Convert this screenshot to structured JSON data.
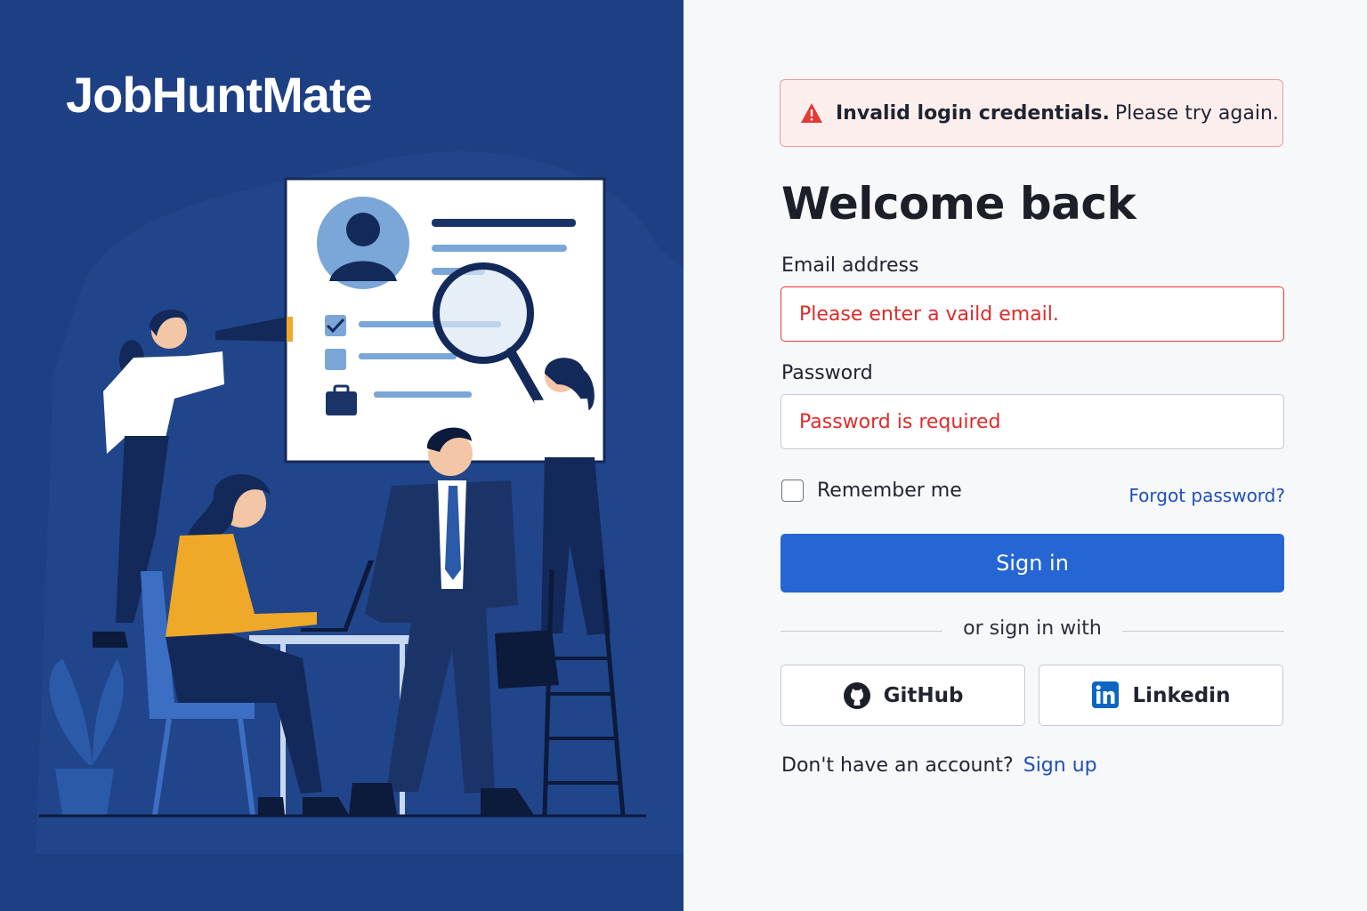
{
  "brand": {
    "name": "JobHuntMate"
  },
  "alert": {
    "strong": "Invalid login credentials.",
    "text": "Please try again.",
    "icon": "warning-triangle-icon",
    "color": "#e53935"
  },
  "form": {
    "title": "Welcome back",
    "email": {
      "label": "Email address",
      "error": "Please enter a vaild email."
    },
    "password": {
      "label": "Password",
      "error": "Password is required"
    },
    "remember_label": "Remember me",
    "remember_checked": false,
    "forgot_label": "Forgot password?",
    "signin_label": "Sign in",
    "divider_text": "or sign in with",
    "social": [
      {
        "label": "GitHub",
        "icon": "github-icon"
      },
      {
        "label": "Linkedin",
        "icon": "linkedin-icon"
      }
    ],
    "signup_prompt": "Don't have an account?",
    "signup_link": "Sign up"
  },
  "colors": {
    "panel": "#1d3f84",
    "primary": "#2566d4",
    "link": "#1f4fb8",
    "error": "#e02a2a",
    "alert_bg": "#fdeeee"
  }
}
